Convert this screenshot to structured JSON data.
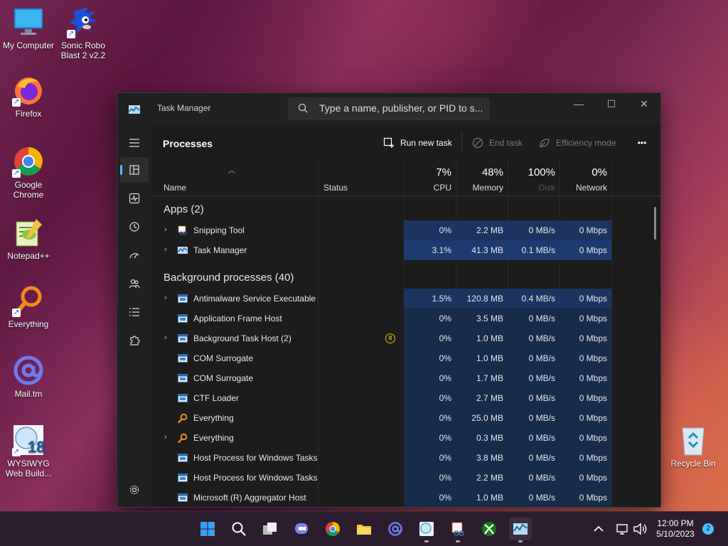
{
  "desktop": {
    "icons": [
      {
        "label": "My Computer"
      },
      {
        "label": "Sonic Robo Blast 2 v2.2"
      },
      {
        "label": "Firefox"
      },
      {
        "label": "Google Chrome"
      },
      {
        "label": "Notepad++"
      },
      {
        "label": "Everything"
      },
      {
        "label": "Mail.tm"
      },
      {
        "label": "WYSIWYG Web Build..."
      },
      {
        "label": "Recycle Bin"
      }
    ]
  },
  "window": {
    "title": "Task Manager",
    "search_placeholder": "Type a name, publisher, or PID to s...",
    "controls": {
      "minimize": "—",
      "maximize": "☐",
      "close": "✕"
    }
  },
  "toolbar": {
    "page_title": "Processes",
    "run_new_task": "Run new task",
    "end_task": "End task",
    "efficiency_mode": "Efficiency mode",
    "more": "•••"
  },
  "table": {
    "headers": {
      "name": "Name",
      "status": "Status",
      "cpu_pct": "7%",
      "cpu": "CPU",
      "memory_pct": "48%",
      "memory": "Memory",
      "disk_pct": "100%",
      "disk": "Disk",
      "network_pct": "0%",
      "network": "Network"
    },
    "groups": {
      "apps": "Apps (2)",
      "background": "Background processes (40)"
    },
    "apps": [
      {
        "name": "Snipping Tool",
        "expandable": true,
        "icon": "snipping-tool-icon",
        "cpu": "0%",
        "mem": "2.2 MB",
        "disk": "0 MB/s",
        "net": "0 Mbps"
      },
      {
        "name": "Task Manager",
        "expandable": true,
        "icon": "task-manager-icon",
        "cpu": "3.1%",
        "mem": "41.3 MB",
        "disk": "0.1 MB/s",
        "net": "0 Mbps"
      }
    ],
    "background": [
      {
        "name": "Antimalware Service Executable",
        "expandable": true,
        "icon": "process-icon",
        "cpu": "1.5%",
        "mem": "120.8 MB",
        "disk": "0.4 MB/s",
        "net": "0 Mbps"
      },
      {
        "name": "Application Frame Host",
        "expandable": false,
        "icon": "process-icon",
        "cpu": "0%",
        "mem": "3.5 MB",
        "disk": "0 MB/s",
        "net": "0 Mbps"
      },
      {
        "name": "Background Task Host (2)",
        "expandable": true,
        "icon": "process-icon",
        "status": "suspended",
        "cpu": "0%",
        "mem": "1.0 MB",
        "disk": "0 MB/s",
        "net": "0 Mbps"
      },
      {
        "name": "COM Surrogate",
        "expandable": false,
        "icon": "process-icon",
        "cpu": "0%",
        "mem": "1.0 MB",
        "disk": "0 MB/s",
        "net": "0 Mbps"
      },
      {
        "name": "COM Surrogate",
        "expandable": false,
        "icon": "process-icon",
        "cpu": "0%",
        "mem": "1.7 MB",
        "disk": "0 MB/s",
        "net": "0 Mbps"
      },
      {
        "name": "CTF Loader",
        "expandable": false,
        "icon": "process-icon",
        "cpu": "0%",
        "mem": "2.7 MB",
        "disk": "0 MB/s",
        "net": "0 Mbps"
      },
      {
        "name": "Everything",
        "expandable": false,
        "icon": "everything-icon",
        "cpu": "0%",
        "mem": "25.0 MB",
        "disk": "0 MB/s",
        "net": "0 Mbps"
      },
      {
        "name": "Everything",
        "expandable": true,
        "icon": "everything-icon",
        "cpu": "0%",
        "mem": "0.3 MB",
        "disk": "0 MB/s",
        "net": "0 Mbps"
      },
      {
        "name": "Host Process for Windows Tasks",
        "expandable": false,
        "icon": "process-icon",
        "cpu": "0%",
        "mem": "3.8 MB",
        "disk": "0 MB/s",
        "net": "0 Mbps"
      },
      {
        "name": "Host Process for Windows Tasks",
        "expandable": false,
        "icon": "process-icon",
        "cpu": "0%",
        "mem": "2.2 MB",
        "disk": "0 MB/s",
        "net": "0 Mbps"
      },
      {
        "name": "Microsoft (R) Aggregator Host",
        "expandable": false,
        "icon": "process-icon",
        "cpu": "0%",
        "mem": "1.0 MB",
        "disk": "0 MB/s",
        "net": "0 Mbps"
      }
    ]
  },
  "taskbar": {
    "clock_time": "12:00 PM",
    "clock_date": "5/10/2023",
    "notification_count": "2"
  },
  "colors": {
    "accent": "#4cc2ff",
    "heat_low": "#172b4a",
    "heat_mid": "#1d3b6e"
  }
}
